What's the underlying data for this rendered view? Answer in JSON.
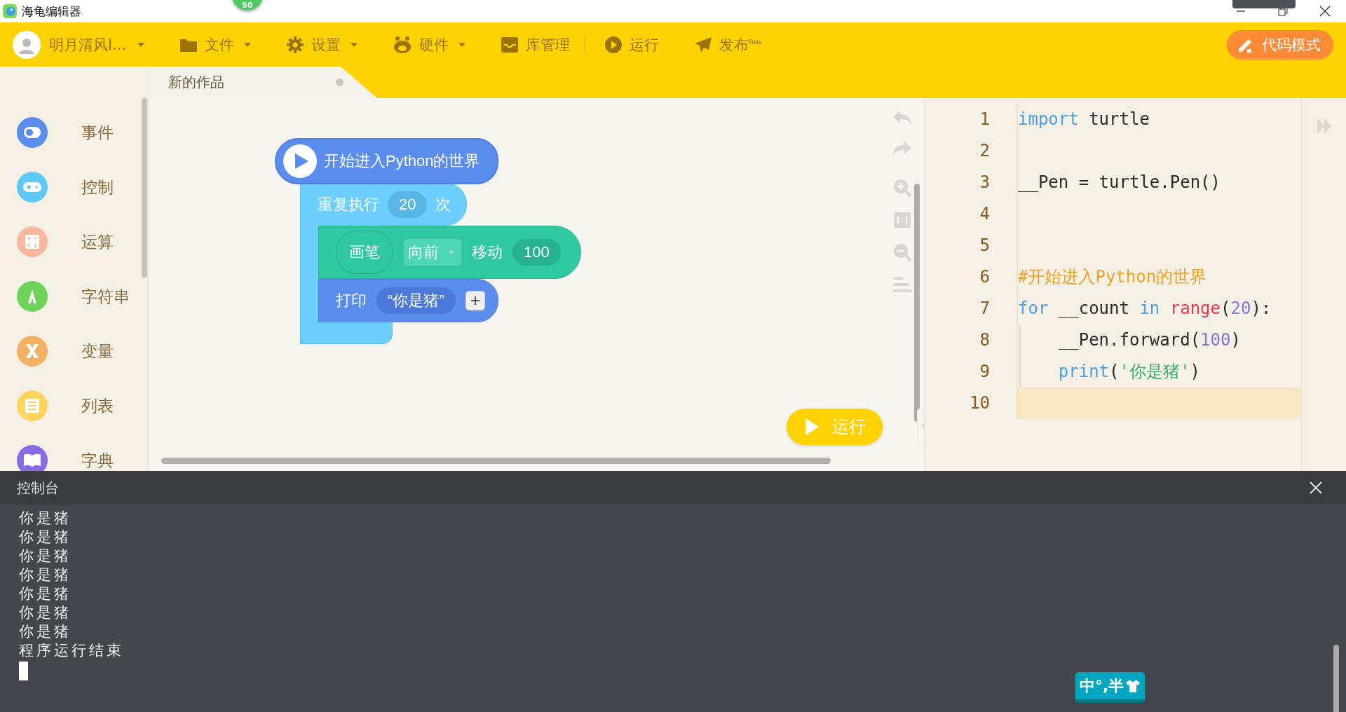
{
  "window": {
    "title": "海龟编辑器",
    "badge": "50"
  },
  "toolbar": {
    "user": "明月清风I...",
    "menus": [
      {
        "label": "文件",
        "dropdown": true
      },
      {
        "label": "设置",
        "dropdown": true
      },
      {
        "label": "硬件",
        "dropdown": true
      },
      {
        "label": "库管理",
        "dropdown": false
      },
      {
        "label": "运行",
        "dropdown": false
      },
      {
        "label": "发布$^{Beta}$",
        "dropdown": false
      }
    ],
    "mode_button": "代码模式"
  },
  "tab": {
    "label": "新的作品",
    "unsaved": true
  },
  "sidebar": {
    "items": [
      {
        "label": "事件",
        "color": "#5b8def"
      },
      {
        "label": "控制",
        "color": "#5ec8f7"
      },
      {
        "label": "运算",
        "color": "#f8b89e"
      },
      {
        "label": "字符串",
        "color": "#6fd35a"
      },
      {
        "label": "变量",
        "color": "#f3b163"
      },
      {
        "label": "列表",
        "color": "#ffd45e"
      },
      {
        "label": "字典",
        "color": "#8a6be6"
      }
    ]
  },
  "blocks": {
    "hat": "开始进入Python的世界",
    "repeat": {
      "label": "重复执行",
      "count": "20",
      "suffix": "次"
    },
    "move": {
      "object": "画笔",
      "direction": "向前",
      "verb": "移动",
      "value": "100"
    },
    "print": {
      "label": "打印",
      "text": "“你是猪”"
    }
  },
  "run_button": "运行",
  "code": {
    "lines": [
      {
        "number": "1",
        "active": false,
        "tokens": [
          {
            "text": "import",
            "kind": "keyword"
          },
          {
            "text": " turtle",
            "kind": "plain"
          }
        ]
      },
      {
        "number": "2",
        "active": false
      },
      {
        "number": "3",
        "active": false,
        "tokens": [
          {
            "text": "__Pen = turtle.Pen()",
            "kind": "plain"
          }
        ]
      },
      {
        "number": "4",
        "active": false
      },
      {
        "number": "5",
        "active": false
      },
      {
        "number": "6",
        "active": false,
        "tokens": [
          {
            "text": "#开始进入Python的世界",
            "kind": "comment"
          }
        ]
      },
      {
        "number": "7",
        "active": false,
        "tokens": [
          {
            "text": "for",
            "kind": "keyword"
          },
          {
            "text": " __count ",
            "kind": "plain"
          },
          {
            "text": "in",
            "kind": "keyword"
          },
          {
            "text": " range",
            "kind": "builtin"
          },
          {
            "text": "(",
            "kind": "plain"
          },
          {
            "text": "20",
            "kind": "number"
          },
          {
            "text": "):",
            "kind": "plain"
          }
        ]
      },
      {
        "number": "8",
        "active": false,
        "tokens": [
          {
            "text": "    __Pen.forward(",
            "kind": "plain"
          },
          {
            "text": "100",
            "kind": "number"
          },
          {
            "text": ")",
            "kind": "plain"
          }
        ]
      },
      {
        "number": "9",
        "active": false,
        "tokens": [
          {
            "text": "    print",
            "kind": "keyword"
          },
          {
            "text": "(",
            "kind": "plain"
          },
          {
            "text": "'你是猪'",
            "kind": "string"
          },
          {
            "text": ")",
            "kind": "plain"
          }
        ]
      },
      {
        "number": "10",
        "active": true
      }
    ]
  },
  "console": {
    "title": "控制台",
    "lines": [
      "你是猪",
      "你是猪",
      "你是猪",
      "你是猪",
      "你是猪",
      "你是猪",
      "你是猪",
      "程序运行结束"
    ]
  },
  "ime_badge": "中°,半"
}
